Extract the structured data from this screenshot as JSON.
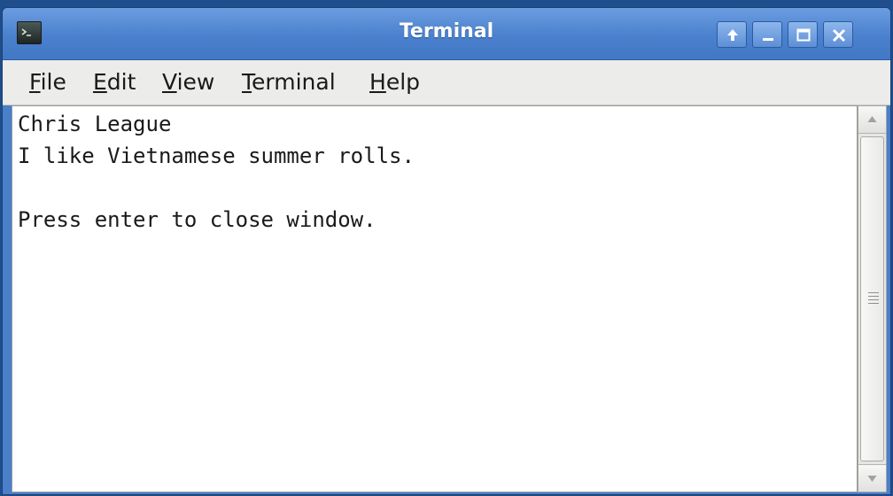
{
  "window": {
    "title": "Terminal",
    "icons": {
      "app": "terminal-icon",
      "controls": [
        "keep-above-icon",
        "minimize-icon",
        "maximize-icon",
        "close-icon"
      ]
    },
    "colors": {
      "titlebar": "#4a80cd",
      "title_text": "#ffffff",
      "menubar": "#ececea",
      "terminal_bg": "#ffffff",
      "terminal_fg": "#1a1a1a"
    }
  },
  "menubar": {
    "items": [
      {
        "mnemonic": "F",
        "rest": "ile"
      },
      {
        "mnemonic": "E",
        "rest": "dit"
      },
      {
        "mnemonic": "V",
        "rest": "iew"
      },
      {
        "mnemonic": "T",
        "rest": "erminal"
      },
      {
        "mnemonic": "H",
        "rest": "elp"
      }
    ]
  },
  "terminal": {
    "lines": [
      "Chris League",
      "I like Vietnamese summer rolls.",
      "",
      "Press enter to close window."
    ]
  }
}
